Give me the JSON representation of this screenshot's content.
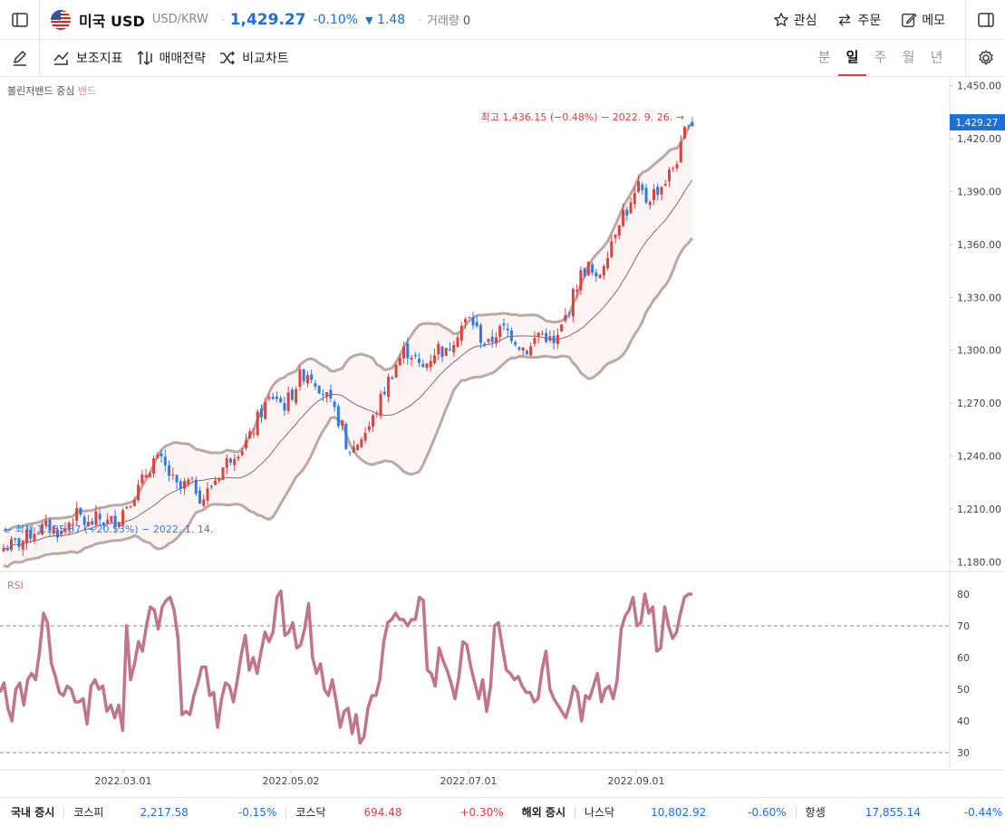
{
  "header": {
    "title": "미국 USD",
    "pair": "USD/KRW",
    "price": "1,429.27",
    "change_pct": "-0.10%",
    "change_abs": "1.48",
    "volume_label": "거래량",
    "volume_value": "0",
    "actions": [
      "관심",
      "주문",
      "메모"
    ]
  },
  "toolbar": {
    "items": [
      "보조지표",
      "매매전략",
      "비교차트"
    ],
    "periods": [
      "분",
      "일",
      "주",
      "월",
      "년"
    ],
    "active_period": "일"
  },
  "chart_data": {
    "type": "candlestick",
    "indicator_label": "볼린저밴드 중심",
    "indicator_sub": "밴드",
    "high_annotation": "최고 1,436.15 (−0.48%) − 2022. 9. 26. →",
    "low_annotation": "← 최저 1,185.87 (+20.53%) − 2022. 1. 14.",
    "current_price_tag": "1,429.27",
    "y_ticks": [
      "1,450.00",
      "1,420.00",
      "1,390.00",
      "1,360.00",
      "1,330.00",
      "1,300.00",
      "1,270.00",
      "1,240.00",
      "1,210.00",
      "1,180.00"
    ],
    "x_ticks": [
      "2022.03.01",
      "2022.05.02",
      "2022.07.01",
      "2022.09.01"
    ],
    "ylim": [
      1175,
      1455
    ],
    "close_path": [
      [
        0,
        1188
      ],
      [
        8,
        1191
      ],
      [
        15,
        1198
      ],
      [
        22,
        1200
      ],
      [
        28,
        1196
      ],
      [
        32,
        1204
      ],
      [
        36,
        1207
      ],
      [
        40,
        1200
      ],
      [
        45,
        1205
      ],
      [
        50,
        1202
      ],
      [
        55,
        1205
      ],
      [
        60,
        1215
      ],
      [
        65,
        1222
      ],
      [
        68,
        1230
      ],
      [
        72,
        1238
      ],
      [
        76,
        1236
      ],
      [
        80,
        1228
      ],
      [
        84,
        1220
      ],
      [
        88,
        1225
      ],
      [
        92,
        1222
      ],
      [
        95,
        1215
      ],
      [
        98,
        1220
      ],
      [
        102,
        1228
      ],
      [
        106,
        1235
      ],
      [
        110,
        1242
      ],
      [
        114,
        1245
      ],
      [
        118,
        1250
      ],
      [
        122,
        1262
      ],
      [
        126,
        1270
      ],
      [
        130,
        1275
      ],
      [
        134,
        1268
      ],
      [
        138,
        1275
      ],
      [
        142,
        1285
      ],
      [
        146,
        1288
      ],
      [
        150,
        1282
      ],
      [
        154,
        1275
      ],
      [
        158,
        1265
      ],
      [
        162,
        1258
      ],
      [
        164,
        1242
      ],
      [
        168,
        1245
      ],
      [
        172,
        1252
      ],
      [
        176,
        1258
      ],
      [
        180,
        1270
      ],
      [
        184,
        1282
      ],
      [
        188,
        1292
      ],
      [
        192,
        1300
      ],
      [
        196,
        1298
      ],
      [
        200,
        1288
      ],
      [
        204,
        1295
      ],
      [
        208,
        1302
      ],
      [
        212,
        1298
      ],
      [
        216,
        1308
      ],
      [
        220,
        1315
      ],
      [
        224,
        1318
      ],
      [
        228,
        1308
      ],
      [
        232,
        1302
      ],
      [
        236,
        1310
      ],
      [
        240,
        1312
      ],
      [
        244,
        1308
      ],
      [
        248,
        1302
      ],
      [
        252,
        1300
      ],
      [
        256,
        1310
      ],
      [
        260,
        1308
      ],
      [
        264,
        1302
      ],
      [
        268,
        1315
      ],
      [
        272,
        1328
      ],
      [
        276,
        1342
      ],
      [
        280,
        1348
      ],
      [
        284,
        1338
      ],
      [
        288,
        1352
      ],
      [
        292,
        1365
      ],
      [
        296,
        1378
      ],
      [
        300,
        1380
      ],
      [
        304,
        1392
      ],
      [
        308,
        1385
      ],
      [
        312,
        1390
      ],
      [
        316,
        1394
      ],
      [
        320,
        1402
      ],
      [
        324,
        1412
      ],
      [
        328,
        1432
      ],
      [
        330,
        1429
      ]
    ],
    "rsi": {
      "label": "RSI",
      "y_ticks": [
        "80",
        "70",
        "60",
        "50",
        "40",
        "30"
      ],
      "ylim": [
        26,
        84
      ],
      "levels": [
        70,
        30
      ],
      "values": [
        49,
        52,
        44,
        40,
        50,
        52,
        45,
        53,
        55,
        53,
        62,
        74,
        71,
        58,
        54,
        49,
        48,
        51,
        50,
        46,
        46,
        47,
        39,
        51,
        53,
        50,
        51,
        43,
        45,
        41,
        45,
        37,
        70,
        53,
        58,
        65,
        62,
        70,
        76,
        75,
        69,
        76,
        78,
        79,
        75,
        66,
        42,
        43,
        42,
        48,
        52,
        57,
        57,
        48,
        49,
        38,
        47,
        52,
        51,
        46,
        53,
        61,
        67,
        56,
        60,
        55,
        62,
        68,
        65,
        68,
        79,
        81,
        67,
        68,
        71,
        63,
        64,
        69,
        77,
        60,
        55,
        58,
        50,
        48,
        53,
        46,
        38,
        43,
        44,
        36,
        42,
        33,
        35,
        44,
        48,
        48,
        53,
        65,
        71,
        72,
        74,
        72,
        72,
        70,
        72,
        72,
        79,
        78,
        56,
        55,
        51,
        63,
        59,
        56,
        52,
        47,
        54,
        65,
        64,
        57,
        52,
        47,
        53,
        43,
        51,
        70,
        71,
        63,
        56,
        55,
        53,
        54,
        51,
        49,
        49,
        46,
        47,
        56,
        62,
        50,
        47,
        45,
        43,
        41,
        45,
        51,
        49,
        40,
        48,
        47,
        51,
        55,
        46,
        50,
        51,
        47,
        53,
        69,
        73,
        75,
        79,
        70,
        71,
        80,
        74,
        76,
        62,
        63,
        76,
        70,
        66,
        68,
        74,
        79,
        80,
        80
      ]
    }
  },
  "footer": {
    "items": [
      {
        "name": "국내 증시",
        "value": "",
        "change": ""
      },
      {
        "name": "코스피",
        "value": "2,217.58",
        "change": "-0.15%"
      },
      {
        "name": "코스닥",
        "value": "694.48",
        "change": "+0.30%"
      },
      {
        "name": "해외 증시",
        "value": "",
        "change": ""
      },
      {
        "name": "나스닥",
        "value": "10,802.92",
        "change": "-0.60%"
      },
      {
        "name": "항셍",
        "value": "17,855.14",
        "change": "-0.44%"
      }
    ]
  },
  "colors": {
    "up": "#e0413d",
    "down": "#2f7be6",
    "band": "#bfa7a3",
    "mid": "#8a6a66",
    "rsi": "#c2748e",
    "price_tag": "#1e6fd6"
  }
}
